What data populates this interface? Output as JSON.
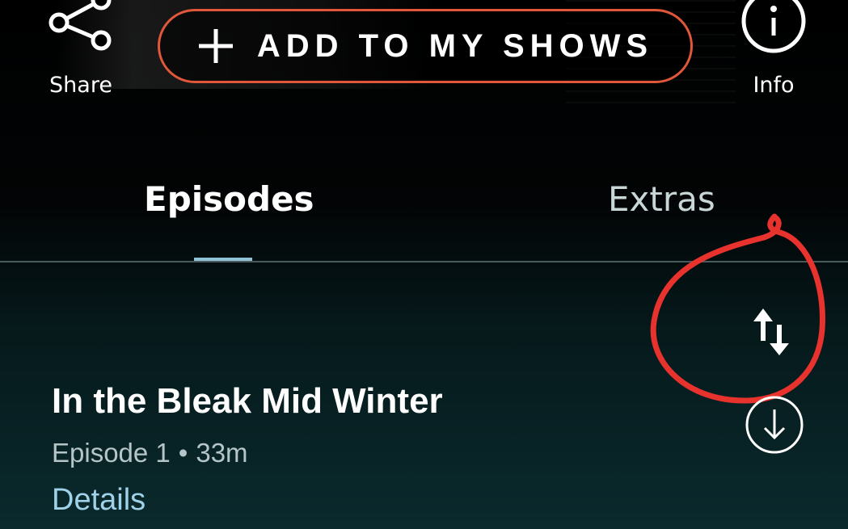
{
  "header": {
    "share_label": "Share",
    "share_icon": "share-icon",
    "add_button_label": "ADD TO MY SHOWS",
    "add_icon": "plus-icon",
    "info_label": "Info",
    "info_icon": "info-icon",
    "accent_color": "#e1573a"
  },
  "tabs": [
    {
      "label": "Episodes",
      "active": true
    },
    {
      "label": "Extras",
      "active": false
    }
  ],
  "toolbar": {
    "sort_icon": "sort-icon",
    "annotation_color": "#e8322e"
  },
  "episodes": [
    {
      "title": "In the Bleak Mid Winter",
      "episode": "Episode 1",
      "separator": "•",
      "duration": "33m",
      "details_label": "Details",
      "download_icon": "download-icon"
    }
  ]
}
